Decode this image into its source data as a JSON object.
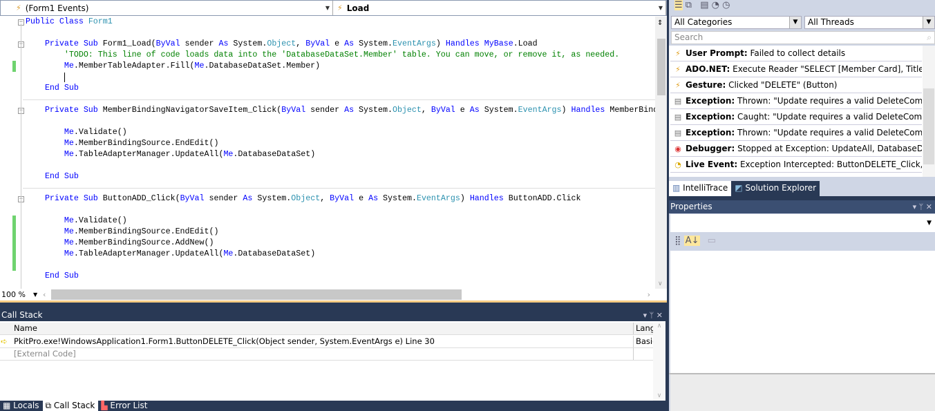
{
  "editor": {
    "nav_left": "(Form1 Events)",
    "nav_right": "Load",
    "zoom": "100 %",
    "colors": {
      "keyword": "#0000ff",
      "type": "#2b91af",
      "comment": "#008000"
    },
    "lines": [
      {
        "n": 0,
        "t": [
          [
            "Public Class ",
            "kw"
          ],
          [
            "Form1",
            "ty"
          ]
        ]
      },
      {
        "n": 2,
        "t": [
          [
            "    Private Sub ",
            "kw"
          ],
          [
            "Form1_Load(",
            "pl"
          ],
          [
            "ByVal ",
            "kw"
          ],
          [
            "sender ",
            "pl"
          ],
          [
            "As ",
            "kw"
          ],
          [
            "System.",
            "pl"
          ],
          [
            "Object",
            "ty"
          ],
          [
            ", ",
            "pl"
          ],
          [
            "ByVal ",
            "kw"
          ],
          [
            "e ",
            "pl"
          ],
          [
            "As ",
            "kw"
          ],
          [
            "System.",
            "pl"
          ],
          [
            "EventArgs",
            "ty"
          ],
          [
            ") ",
            "pl"
          ],
          [
            "Handles ",
            "kw"
          ],
          [
            "MyBase",
            "kw"
          ],
          [
            ".Load",
            "pl"
          ]
        ]
      },
      {
        "n": 3,
        "t": [
          [
            "        'TODO: This line of code loads data into the 'DatabaseDataSet.Member' table. You can move, or remove it, as needed.",
            "cm"
          ]
        ]
      },
      {
        "n": 4,
        "t": [
          [
            "        ",
            "pl"
          ],
          [
            "Me",
            "kw"
          ],
          [
            ".MemberTableAdapter.Fill(",
            "pl"
          ],
          [
            "Me",
            "kw"
          ],
          [
            ".DatabaseDataSet.Member)",
            "pl"
          ]
        ]
      },
      {
        "n": 6,
        "t": [
          [
            "    End Sub",
            "kw"
          ]
        ]
      },
      {
        "n": 8,
        "t": [
          [
            "    Private Sub ",
            "kw"
          ],
          [
            "MemberBindingNavigatorSaveItem_Click(",
            "pl"
          ],
          [
            "ByVal ",
            "kw"
          ],
          [
            "sender ",
            "pl"
          ],
          [
            "As ",
            "kw"
          ],
          [
            "System.",
            "pl"
          ],
          [
            "Object",
            "ty"
          ],
          [
            ", ",
            "pl"
          ],
          [
            "ByVal ",
            "kw"
          ],
          [
            "e ",
            "pl"
          ],
          [
            "As ",
            "kw"
          ],
          [
            "System.",
            "pl"
          ],
          [
            "EventArgs",
            "ty"
          ],
          [
            ") ",
            "pl"
          ],
          [
            "Handles ",
            "kw"
          ],
          [
            "MemberBindingNavigatorSaveItem.Click",
            "pl"
          ]
        ]
      },
      {
        "n": 10,
        "t": [
          [
            "        ",
            "pl"
          ],
          [
            "Me",
            "kw"
          ],
          [
            ".Validate()",
            "pl"
          ]
        ]
      },
      {
        "n": 11,
        "t": [
          [
            "        ",
            "pl"
          ],
          [
            "Me",
            "kw"
          ],
          [
            ".MemberBindingSource.EndEdit()",
            "pl"
          ]
        ]
      },
      {
        "n": 12,
        "t": [
          [
            "        ",
            "pl"
          ],
          [
            "Me",
            "kw"
          ],
          [
            ".TableAdapterManager.UpdateAll(",
            "pl"
          ],
          [
            "Me",
            "kw"
          ],
          [
            ".DatabaseDataSet)",
            "pl"
          ]
        ]
      },
      {
        "n": 14,
        "t": [
          [
            "    End Sub",
            "kw"
          ]
        ]
      },
      {
        "n": 16,
        "t": [
          [
            "    Private Sub ",
            "kw"
          ],
          [
            "ButtonADD_Click(",
            "pl"
          ],
          [
            "ByVal ",
            "kw"
          ],
          [
            "sender ",
            "pl"
          ],
          [
            "As ",
            "kw"
          ],
          [
            "System.",
            "pl"
          ],
          [
            "Object",
            "ty"
          ],
          [
            ", ",
            "pl"
          ],
          [
            "ByVal ",
            "kw"
          ],
          [
            "e ",
            "pl"
          ],
          [
            "As ",
            "kw"
          ],
          [
            "System.",
            "pl"
          ],
          [
            "EventArgs",
            "ty"
          ],
          [
            ") ",
            "pl"
          ],
          [
            "Handles ",
            "kw"
          ],
          [
            "ButtonADD.Click",
            "pl"
          ]
        ]
      },
      {
        "n": 18,
        "t": [
          [
            "        ",
            "pl"
          ],
          [
            "Me",
            "kw"
          ],
          [
            ".Validate()",
            "pl"
          ]
        ]
      },
      {
        "n": 19,
        "t": [
          [
            "        ",
            "pl"
          ],
          [
            "Me",
            "kw"
          ],
          [
            ".MemberBindingSource.EndEdit()",
            "pl"
          ]
        ]
      },
      {
        "n": 20,
        "t": [
          [
            "        ",
            "pl"
          ],
          [
            "Me",
            "kw"
          ],
          [
            ".MemberBindingSource.AddNew()",
            "pl"
          ]
        ]
      },
      {
        "n": 21,
        "t": [
          [
            "        ",
            "pl"
          ],
          [
            "Me",
            "kw"
          ],
          [
            ".TableAdapterManager.UpdateAll(",
            "pl"
          ],
          [
            "Me",
            "kw"
          ],
          [
            ".DatabaseDataSet)",
            "pl"
          ]
        ]
      },
      {
        "n": 23,
        "t": [
          [
            "    End Sub",
            "kw"
          ]
        ]
      }
    ]
  },
  "callstack": {
    "title": "Call Stack",
    "controls": "▾ ᛘ ✕",
    "col_name": "Name",
    "col_lang": "Lang",
    "rows": [
      {
        "name": "PkitPro.exe!WindowsApplication1.Form1.ButtonDELETE_Click(Object sender, System.EventArgs e) Line 30",
        "lang": "Basic",
        "current": true
      },
      {
        "name": "[External Code]",
        "lang": ""
      }
    ]
  },
  "bottom_tabs": [
    "Locals",
    "Call Stack",
    "Error List"
  ],
  "intellitrace": {
    "category": "All Categories",
    "threads": "All Threads",
    "search_placeholder": "Search",
    "events": [
      {
        "icon": "lightning",
        "label": "User Prompt:",
        "text": " Failed to collect details"
      },
      {
        "icon": "lightning",
        "label": "ADO.NET:",
        "text": " Execute Reader \"SELECT [Member Card], Title, [Firs"
      },
      {
        "icon": "lightning",
        "label": "Gesture:",
        "text": " Clicked \"DELETE\" (Button)"
      },
      {
        "icon": "exception",
        "label": "Exception:",
        "text": " Thrown: \"Update requires a valid DeleteCommanc"
      },
      {
        "icon": "exception",
        "label": "Exception:",
        "text": " Caught: \"Update requires a valid DeleteCommand"
      },
      {
        "icon": "exception",
        "label": "Exception:",
        "text": " Thrown: \"Update requires a valid DeleteCommanc"
      },
      {
        "icon": "stop",
        "label": "Debugger:",
        "text": " Stopped at Exception: UpdateAll, DatabaseDataSet"
      },
      {
        "icon": "live-event",
        "label": "Live Event:",
        "text": " Exception Intercepted: ButtonDELETE_Click, Form"
      }
    ],
    "tabs": [
      "IntelliTrace",
      "Solution Explorer"
    ]
  },
  "properties": {
    "title": "Properties",
    "controls": "▾ ᛘ ✕"
  }
}
